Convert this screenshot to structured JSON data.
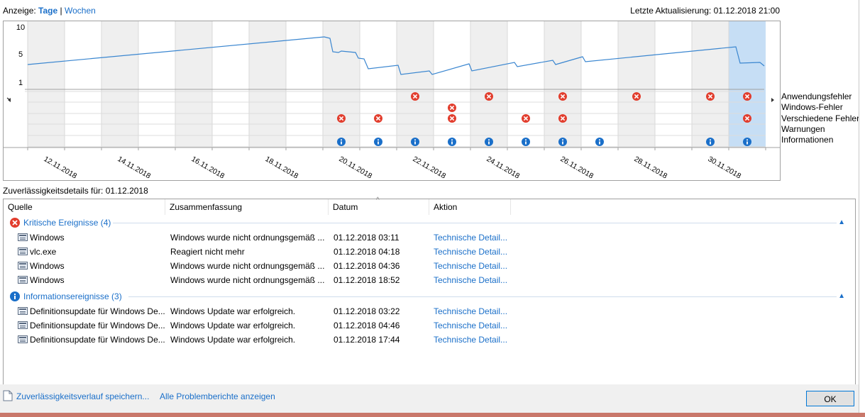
{
  "topbar": {
    "prefix": "Anzeige:",
    "days": "Tage",
    "separator": "|",
    "weeks": "Wochen"
  },
  "last_update": "Letzte Aktualisierung: 01.12.2018 21:00",
  "chart": {
    "y_ticks": [
      "10",
      "5",
      "1"
    ],
    "legend": [
      "Anwendungsfehler",
      "Windows-Fehler",
      "Verschiedene Fehler",
      "Warnungen",
      "Informationen"
    ],
    "date_labels": [
      "12.11.2018",
      "14.11.2018",
      "16.11.2018",
      "18.11.2018",
      "20.11.2018",
      "22.11.2018",
      "24.11.2018",
      "26.11.2018",
      "28.11.2018",
      "30.11.2018"
    ],
    "colors": {
      "error": "#e23d2d",
      "info": "#1a6fc9",
      "line": "#3a86d0",
      "shade": "#efefef",
      "selected": "#c6def5"
    }
  },
  "details_title": "Zuverlässigkeitsdetails für: 01.12.2018",
  "table": {
    "headers": [
      "Quelle",
      "Zusammenfassung",
      "Datum",
      "Aktion"
    ],
    "groups": [
      {
        "title": "Kritische Ereignisse (4)",
        "icon": "error-icon",
        "rows": [
          {
            "source": "Windows",
            "summary": "Windows wurde nicht ordnungsgemäß ...",
            "date": "01.12.2018 03:11",
            "action": "Technische Detail..."
          },
          {
            "source": "vlc.exe",
            "summary": "Reagiert nicht mehr",
            "date": "01.12.2018 04:18",
            "action": "Technische Detail..."
          },
          {
            "source": "Windows",
            "summary": "Windows wurde nicht ordnungsgemäß ...",
            "date": "01.12.2018 04:36",
            "action": "Technische Detail..."
          },
          {
            "source": "Windows",
            "summary": "Windows wurde nicht ordnungsgemäß ...",
            "date": "01.12.2018 18:52",
            "action": "Technische Detail..."
          }
        ]
      },
      {
        "title": "Informationsereignisse (3)",
        "icon": "info-icon",
        "rows": [
          {
            "source": "Definitionsupdate für Windows De...",
            "summary": "Windows Update war erfolgreich.",
            "date": "01.12.2018 03:22",
            "action": "Technische Detail..."
          },
          {
            "source": "Definitionsupdate für Windows De...",
            "summary": "Windows Update war erfolgreich.",
            "date": "01.12.2018 04:46",
            "action": "Technische Detail..."
          },
          {
            "source": "Definitionsupdate für Windows De...",
            "summary": "Windows Update war erfolgreich.",
            "date": "01.12.2018 17:44",
            "action": "Technische Detail..."
          }
        ]
      }
    ]
  },
  "footer": {
    "save_link": "Zuverlässigkeitsverlauf speichern...",
    "reports_link": "Alle Problemberichte anzeigen",
    "ok": "OK"
  }
}
